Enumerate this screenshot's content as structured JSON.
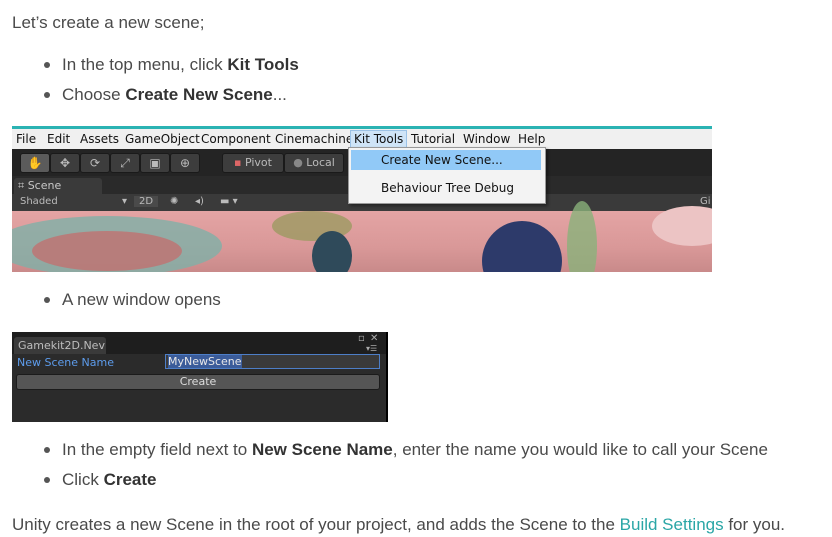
{
  "intro": "Let’s create a new scene;",
  "steps_1": [
    {
      "pre": "In the top menu, click ",
      "bold": "Kit Tools",
      "post": ""
    },
    {
      "pre": "Choose ",
      "bold": "Create New Scene",
      "post": "..."
    }
  ],
  "unity_menu": {
    "menubar": [
      "File",
      "Edit",
      "Assets",
      "GameObject",
      "Component",
      "Cinemachine",
      "Kit Tools",
      "Tutorial",
      "Window",
      "Help"
    ],
    "active_menu": "Kit Tools",
    "toolbar": {
      "pivot_label": "Pivot",
      "local_label": "Local"
    },
    "scene_tab": "Scene",
    "subbar": {
      "shading": "Shaded",
      "mode_2d": "2D",
      "gizmos": "Gi"
    },
    "dropdown_items": [
      "Create New Scene...",
      "Behaviour Tree Debug"
    ],
    "highlighted_item": "Create New Scene..."
  },
  "step_window": {
    "pre": "A new window opens",
    "bold": "",
    "post": ""
  },
  "gamekit_window": {
    "tab_title": "Gamekit2D.Nev",
    "field_label": "New Scene Name",
    "field_value": "MyNewScene",
    "button_label": "Create"
  },
  "steps_2": [
    {
      "pre": "In the empty field next to ",
      "bold": "New Scene Name",
      "post": ", enter the name you would like to call your Scene"
    },
    {
      "pre": "Click ",
      "bold": "Create",
      "post": ""
    }
  ],
  "outro": {
    "pre": "Unity creates a new Scene in the root of your project, and adds the Scene to the ",
    "link": "Build Settings",
    "post": " for you."
  },
  "colors": {
    "link": "#2aa6a6",
    "accent_line": "#2bb3b3",
    "menu_highlight": "#91c9f7"
  }
}
